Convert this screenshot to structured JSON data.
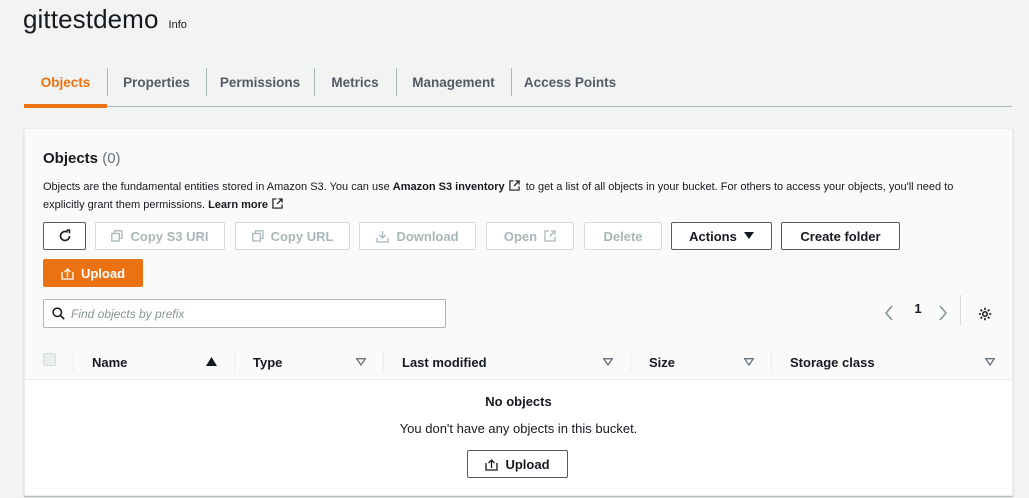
{
  "bucket": {
    "name": "gittestdemo",
    "info_label": "Info"
  },
  "tabs": [
    {
      "label": "Objects",
      "active": true
    },
    {
      "label": "Properties",
      "active": false
    },
    {
      "label": "Permissions",
      "active": false
    },
    {
      "label": "Metrics",
      "active": false
    },
    {
      "label": "Management",
      "active": false
    },
    {
      "label": "Access Points",
      "active": false
    }
  ],
  "objects_panel": {
    "title": "Objects",
    "count": "(0)",
    "description": {
      "part1": "Objects are the fundamental entities stored in Amazon S3. You can use",
      "inventory_link": "Amazon S3 inventory",
      "part2": "to get a list of all objects in your bucket. For others to access your objects, you'll need to explicitly grant them permissions.",
      "learn_more": "Learn more"
    },
    "buttons": {
      "refresh_icon": "refresh-icon",
      "copy_s3_uri": "Copy S3 URI",
      "copy_url": "Copy URL",
      "download": "Download",
      "open": "Open",
      "delete": "Delete",
      "actions": "Actions",
      "create_folder": "Create folder",
      "upload": "Upload"
    },
    "search": {
      "placeholder": "Find objects by prefix",
      "value": ""
    },
    "pagination": {
      "current_page": "1"
    },
    "table": {
      "columns": [
        "Name",
        "Type",
        "Last modified",
        "Size",
        "Storage class"
      ]
    },
    "empty_state": {
      "title": "No objects",
      "message": "You don't have any objects in this bucket.",
      "upload_label": "Upload"
    }
  },
  "colors": {
    "accent": "#ec7211",
    "text": "#16191f",
    "muted": "#545b64",
    "border": "#aab7b8",
    "background": "#f2f3f3"
  }
}
